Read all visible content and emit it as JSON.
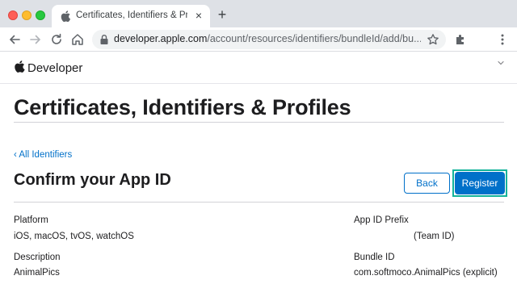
{
  "browser": {
    "tab_title": "Certificates, Identifiers & Profil",
    "url_host": "developer.apple.com",
    "url_path": "/account/resources/identifiers/bundleId/add/bu...",
    "colors": {
      "tabstrip": "#dee1e6",
      "close": "#fe5f57",
      "minimize": "#febc2e",
      "zoom": "#28c840"
    },
    "icons": [
      "back-arrow-icon",
      "forward-arrow-icon",
      "reload-icon",
      "home-icon",
      "lock-icon",
      "star-icon",
      "extensions-icon",
      "menu-icon"
    ]
  },
  "devbar": {
    "label": "Developer"
  },
  "page": {
    "title": "Certificates, Identifiers & Profiles",
    "back_link": "‹ All Identifiers",
    "section_title": "Confirm your App ID",
    "back_button": "Back",
    "register_button": "Register"
  },
  "fields": {
    "platform_label": "Platform",
    "platform_value": "iOS, macOS, tvOS, watchOS",
    "prefix_label": "App ID Prefix",
    "prefix_value": "(Team ID)",
    "description_label": "Description",
    "description_value": "AnimalPics",
    "bundle_label": "Bundle ID",
    "bundle_value": "com.softmoco.AnimalPics (explicit)"
  },
  "colors": {
    "accent": "#0070c9",
    "highlight": "#12b39a",
    "text": "#1d1d1f"
  }
}
